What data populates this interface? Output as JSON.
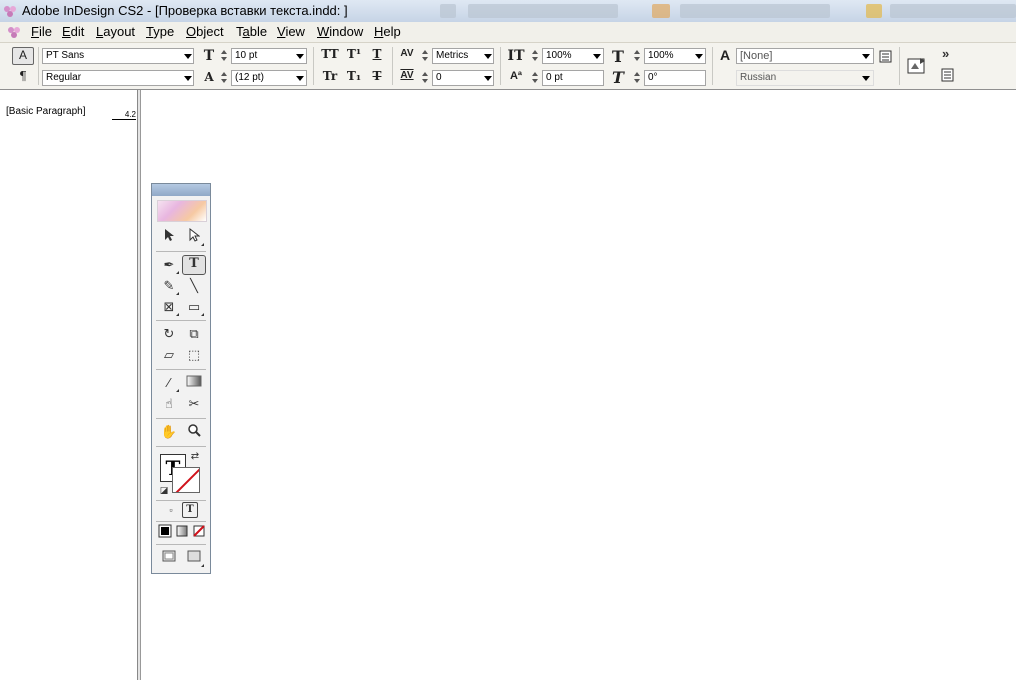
{
  "window": {
    "title": "Adobe InDesign CS2 - [Проверка вставки текста.indd: ]"
  },
  "menu": {
    "items": [
      {
        "label": "File",
        "accel": "F"
      },
      {
        "label": "Edit",
        "accel": "E"
      },
      {
        "label": "Layout",
        "accel": "L"
      },
      {
        "label": "Type",
        "accel": "T"
      },
      {
        "label": "Object",
        "accel": "O"
      },
      {
        "label": "Table",
        "accel": "a"
      },
      {
        "label": "View",
        "accel": "V"
      },
      {
        "label": "Window",
        "accel": "W"
      },
      {
        "label": "Help",
        "accel": "H"
      }
    ]
  },
  "control": {
    "font_family": "PT Sans",
    "font_style": "Regular",
    "font_size": "10 pt",
    "leading": "(12 pt)",
    "kerning": "Metrics",
    "tracking": "0",
    "vertical_scale": "100%",
    "horizontal_scale": "100%",
    "baseline_shift": "0 pt",
    "skew": "0°",
    "char_style": "[None]",
    "language": "Russian",
    "more_label": "»"
  },
  "paragraph_styles": {
    "items": [
      {
        "name": "[Basic Paragraph]",
        "count": "4.2"
      }
    ]
  },
  "tools": {
    "selected": "type-tool",
    "fill_glyph": "T"
  },
  "colors": {
    "accent": "#d0121b",
    "titlebar": "#c6d4e6",
    "panel": "#f4f3ee"
  }
}
